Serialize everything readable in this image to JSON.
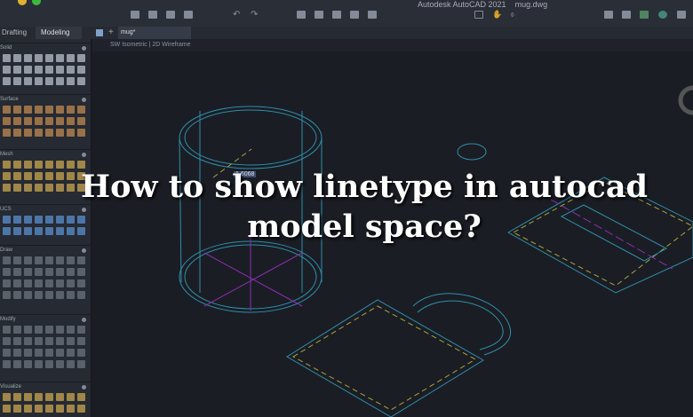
{
  "app": {
    "title": "Autodesk AutoCAD 2021",
    "file": "mug.dwg"
  },
  "workspace_tabs": [
    {
      "label": "Drafting"
    },
    {
      "label": "Modeling"
    }
  ],
  "doc_tab": "mug*",
  "viewport": {
    "view": "SW Isometric",
    "style": "2D Wireframe",
    "header": "SW Isometric | 2D Wireframe"
  },
  "palette_sections": [
    {
      "label": "Solid"
    },
    {
      "label": "Surface"
    },
    {
      "label": "Mesh"
    },
    {
      "label": "UCS"
    },
    {
      "label": "Draw"
    },
    {
      "label": "Modify"
    },
    {
      "label": "Visualize"
    }
  ],
  "dimension_value": "1.6068",
  "headline": "How to show linetype in autocad model space?",
  "colors": {
    "cyan": "#2e8fa8",
    "purple": "#8a2fb0",
    "yellow": "#a9a23a",
    "bg": "#1b1d25"
  }
}
